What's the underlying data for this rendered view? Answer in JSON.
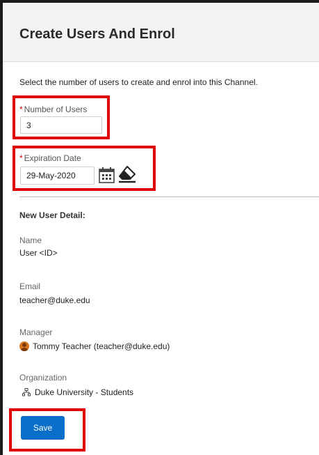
{
  "header": {
    "title": "Create Users And Enrol"
  },
  "form": {
    "instructions": "Select the number of users to create and enrol into this Channel.",
    "required_marker": "*",
    "number_of_users": {
      "label": "Number of Users",
      "value": "3"
    },
    "expiration_date": {
      "label": "Expiration Date",
      "value": "29-May-2020",
      "calendar_icon": "calendar-icon",
      "clear_icon": "eraser-icon"
    }
  },
  "new_user_detail": {
    "heading": "New User Detail:",
    "name": {
      "label": "Name",
      "value": "User <ID>"
    },
    "email": {
      "label": "Email",
      "value": "teacher@duke.edu"
    },
    "manager": {
      "label": "Manager",
      "value": "Tommy Teacher (teacher@duke.edu)",
      "icon": "user-avatar-icon"
    },
    "organization": {
      "label": "Organization",
      "value": "Duke University - Students",
      "icon": "org-chart-icon"
    }
  },
  "actions": {
    "save_label": "Save"
  },
  "colors": {
    "highlight": "#e00000",
    "primary": "#0a6fc9",
    "header_bg": "#f3f3f3"
  }
}
